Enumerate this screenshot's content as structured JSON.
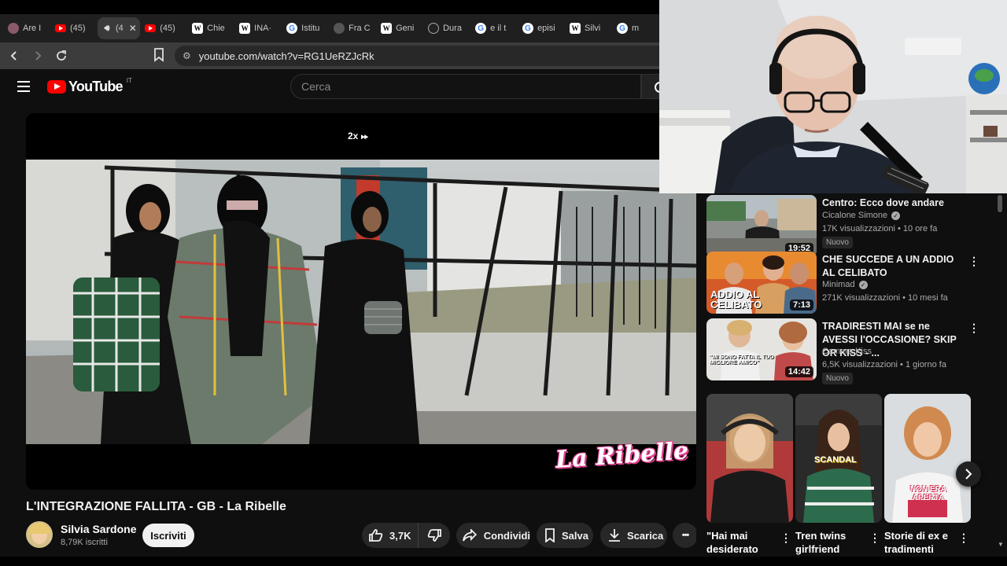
{
  "browser": {
    "tabs": [
      {
        "icon": "avatar-icon",
        "label": "Are I"
      },
      {
        "icon": "youtube-icon",
        "label": "(45)"
      },
      {
        "icon": "speaker-icon",
        "label": "(4",
        "active": true
      },
      {
        "icon": "youtube-icon",
        "label": "(45)"
      },
      {
        "icon": "wikipedia-icon",
        "label": "Chie"
      },
      {
        "icon": "wikipedia-icon",
        "label": "INA·"
      },
      {
        "icon": "google-icon",
        "label": "Istitu"
      },
      {
        "icon": "globe-icon",
        "label": "Fra C"
      },
      {
        "icon": "wikipedia-icon",
        "label": "Geni"
      },
      {
        "icon": "site-icon",
        "label": "Dura"
      },
      {
        "icon": "google-icon",
        "label": "e il t"
      },
      {
        "icon": "google-icon",
        "label": "episi"
      },
      {
        "icon": "wikipedia-icon",
        "label": "Silvi"
      },
      {
        "icon": "google-icon",
        "label": "m"
      }
    ],
    "url": "youtube.com/watch?v=RG1UeRZJcRk"
  },
  "youtube": {
    "logo_text": "YouTube",
    "country_code": "IT",
    "search_placeholder": "Cerca"
  },
  "player": {
    "speed_label": "2x",
    "watermark": "La Ribelle"
  },
  "video": {
    "title": "L'INTEGRAZIONE FALLITA - GB - La Ribelle",
    "channel": "Silvia Sardone",
    "subscribers": "8,79K iscritti",
    "subscribe_label": "Iscriviti",
    "likes": "3,7K",
    "share_label": "Condividi",
    "save_label": "Salva",
    "download_label": "Scarica",
    "more_label": "•••"
  },
  "recommendations": [
    {
      "title": "Centro: Ecco dove andare",
      "channel": "Cicalone Simone",
      "verified": true,
      "meta": "17K visualizzazioni • 10 ore fa",
      "badge": "Nuovo",
      "duration": "19:52"
    },
    {
      "title": "CHE SUCCEDE A UN ADDIO AL CELIBATO",
      "channel": "Minimad",
      "verified": true,
      "meta": "271K visualizzazioni • 10 mesi fa",
      "badge": "",
      "duration": "7:13",
      "thumb_text": "ADDIO AL CELIBATO"
    },
    {
      "title": "TRADIRESTI MAI se ne AVESSI l'OCCASIONE? SKIP OR KISS - ...",
      "channel": "Camera Kiss",
      "verified": false,
      "meta": "6,5K visualizzazioni • 1 giorno fa",
      "badge": "Nuovo",
      "duration": "14:42",
      "thumb_text": "\"MI SONO FATTA IL TUO MIGLIORE AMICO\""
    }
  ],
  "shorts": [
    {
      "title": "\"Hai mai desiderato",
      "thumb_text": ""
    },
    {
      "title": "Tren twins girlfriend",
      "thumb_text": "SCANDAL"
    },
    {
      "title": "Storie di ex e tradimenti",
      "thumb_text": "NON ERA APERTA"
    }
  ]
}
